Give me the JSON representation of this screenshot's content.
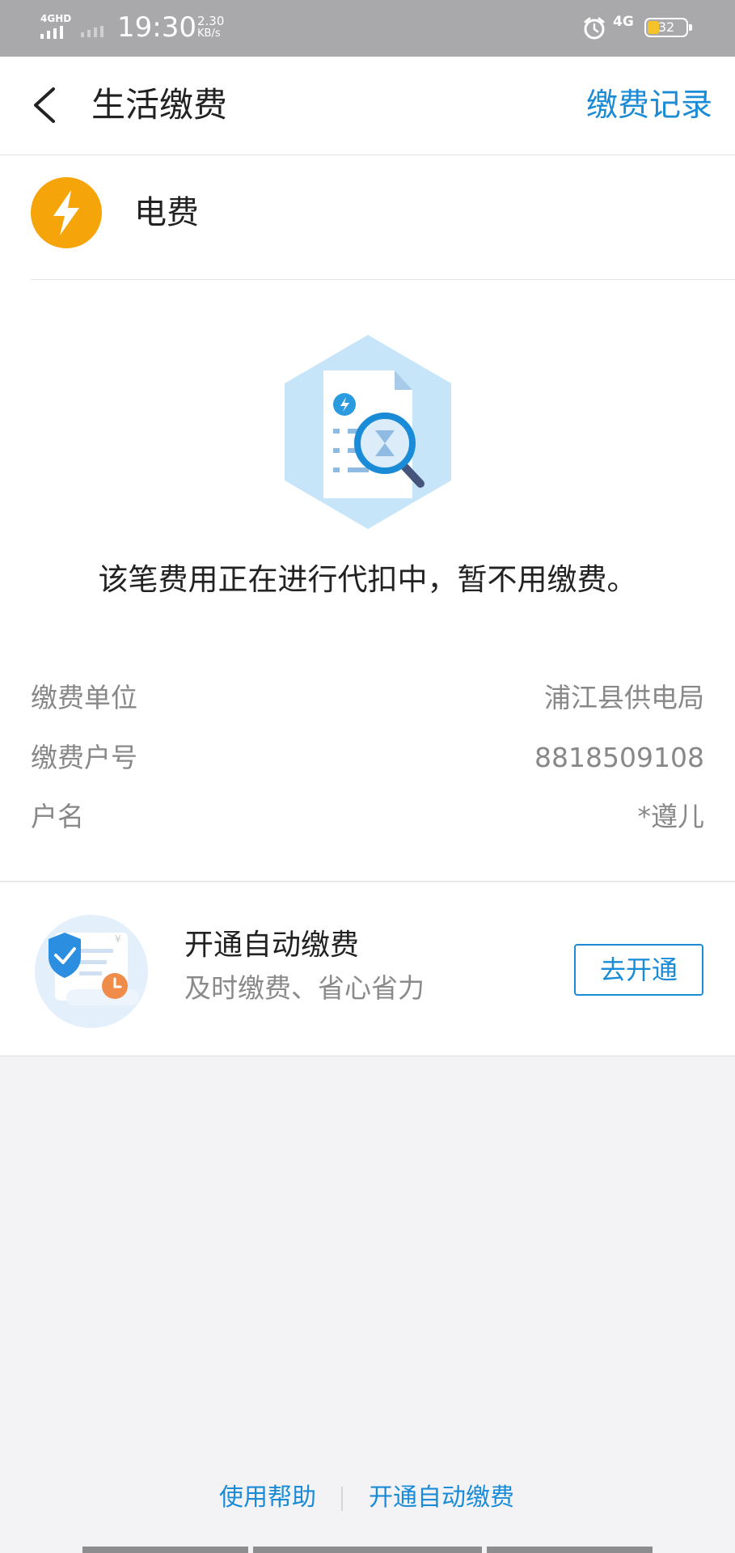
{
  "status_bar": {
    "network": "4GHD",
    "time": "19:30",
    "speed_value": "2.30",
    "speed_unit": "KB/s",
    "network_right": "4G",
    "battery": "32",
    "battery_color": "#f5c227"
  },
  "header": {
    "back_icon": "chevron-left-icon",
    "title": "生活缴费",
    "action_label": "缴费记录"
  },
  "bill": {
    "icon": "lightning-icon",
    "icon_color": "#f5a50a",
    "name": "电费"
  },
  "status_illustration": "document-search-icon",
  "status_message": "该笔费用正在进行代扣中，暂不用缴费。",
  "details": [
    {
      "label": "缴费单位",
      "value": "浦江县供电局"
    },
    {
      "label": "缴费户号",
      "value": "8818509108"
    },
    {
      "label": "户名",
      "value": "*遵儿"
    }
  ],
  "autopay": {
    "icon": "shield-bill-icon",
    "title": "开通自动缴费",
    "subtitle": "及时缴费、省心省力",
    "button_label": "去开通"
  },
  "footer": {
    "help_label": "使用帮助",
    "autopay_label": "开通自动缴费"
  },
  "colors": {
    "accent": "#1a8bd6",
    "background": "#f3f3f6"
  }
}
